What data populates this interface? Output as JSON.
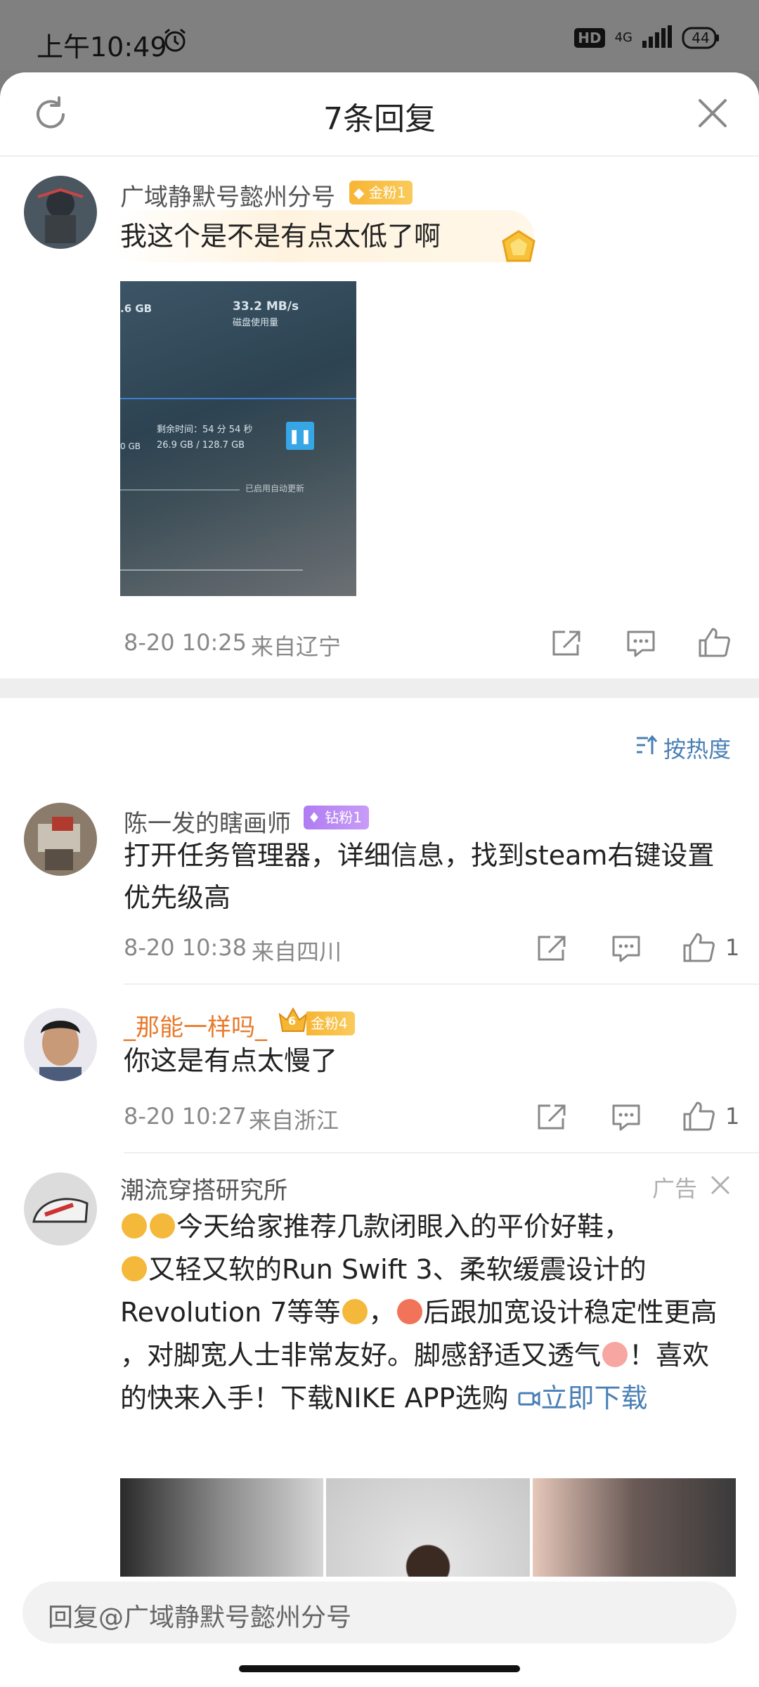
{
  "status_bar": {
    "time": "上午10:49",
    "hd": "HD",
    "network": "4G",
    "battery": "44"
  },
  "header": {
    "title": "7条回复"
  },
  "main_comment": {
    "username": "广域静默号懿州分号",
    "badge": "金粉1",
    "text": "我这个是不是有点太低了啊",
    "image": {
      "speed": "33.2 MB/s",
      "disk_label": "磁盘使用量",
      "size_left": ".6 GB",
      "remaining": "剩余时间：54 分 54 秒",
      "progress": "26.9 GB / 128.7 GB",
      "gb_prefix": "0 GB",
      "auto_update": "已启用自动更新"
    },
    "date": "8-20 10:25",
    "location": "来自辽宁"
  },
  "sort": {
    "label": "按热度"
  },
  "replies": [
    {
      "username": "陈一发的瞎画师",
      "badge": "钻粉1",
      "text": "打开任务管理器，详细信息，找到steam右键设置优先级高",
      "date": "8-20 10:38",
      "location": "来自四川",
      "likes": "1"
    },
    {
      "username": "_那能一样吗_",
      "badge": "金粉4",
      "badge_level": "6",
      "text": "你这是有点太慢了",
      "date": "8-20 10:27",
      "location": "来自浙江",
      "likes": "1"
    }
  ],
  "ad": {
    "username": "潮流穿搭研究所",
    "tag": "广告",
    "text_1": "今天给家推荐几款闭眼入的平价好鞋，",
    "text_2": "又轻又软的Run Swift 3、柔软缓震设计的Revolution 7等等",
    "text_3": "，",
    "text_4": "后跟加宽设计稳定性更高 ，对脚宽人士非常友好。脚感舒适又透气",
    "text_5": "！喜欢的快来入手！下载NIKE APP选购 ",
    "link": "立即下载"
  },
  "reply_bar": {
    "placeholder": "回复@广域静默号懿州分号"
  }
}
